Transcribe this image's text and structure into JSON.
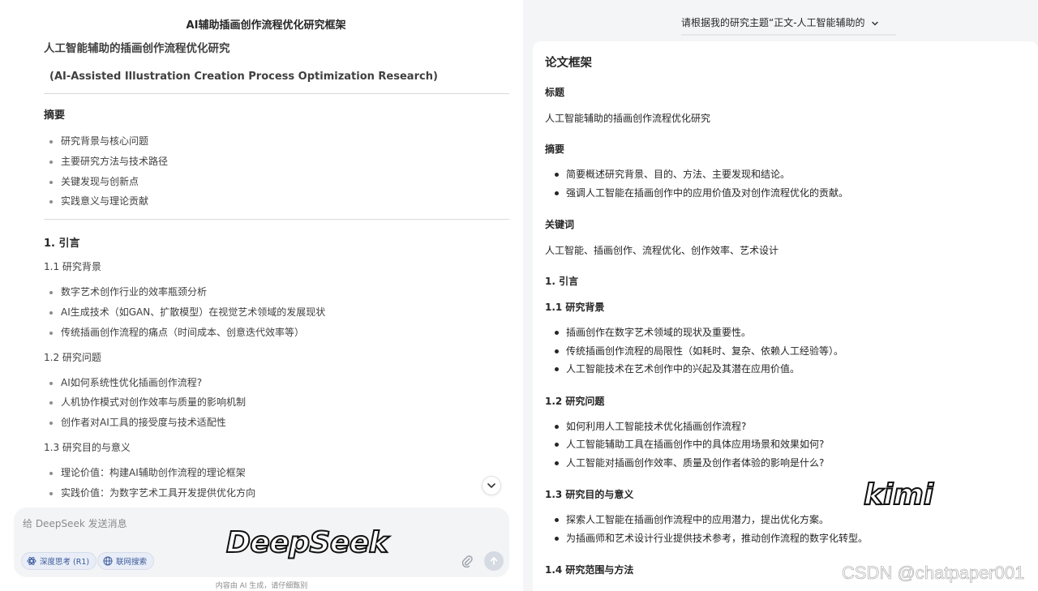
{
  "left": {
    "title": "AI辅助插画创作流程优化研究框架",
    "heading": "人工智能辅助的插画创作流程优化研究",
    "subheading": "(AI-Assisted Illustration Creation Process Optimization Research)",
    "abstract_title": "摘要",
    "abstract_items": [
      "研究背景与核心问题",
      "主要研究方法与技术路径",
      "关键发现与创新点",
      "实践意义与理论贡献"
    ],
    "sec1_title": "1. 引言",
    "s11_title": "1.1 研究背景",
    "s11_items": [
      "数字艺术创作行业的效率瓶颈分析",
      "AI生成技术（如GAN、扩散模型）在视觉艺术领域的发展现状",
      "传统插画创作流程的痛点（时间成本、创意迭代效率等）"
    ],
    "s12_title": "1.2 研究问题",
    "s12_items": [
      "AI如何系统性优化插画创作流程?",
      "人机协作模式对创作效率与质量的影响机制",
      "创作者对AI工具的接受度与技术适配性"
    ],
    "s13_title": "1.3 研究目的与意义",
    "s13_items": [
      "理论价值：构建AI辅助创作流程的理论框架",
      "实践价值：为数字艺术工具开发提供优化方向"
    ],
    "input_placeholder": "给 DeepSeek 发送消息",
    "chip_deepthink": "深度思考 (R1)",
    "chip_search": "联网搜索",
    "footnote": "内容由 AI 生成，请仔细甄别",
    "watermark": "DeepSeek"
  },
  "right": {
    "top_query": "请根据我的研究主题“正文-人工智能辅助的",
    "outline_title": "论文框架",
    "title_label": "标题",
    "title_value": "人工智能辅助的插画创作流程优化研究",
    "abstract_label": "摘要",
    "abstract_items": [
      "简要概述研究背景、目的、方法、主要发现和结论。",
      "强调人工智能在插画创作中的应用价值及对创作流程优化的贡献。"
    ],
    "keywords_label": "关键词",
    "keywords_value": "人工智能、插画创作、流程优化、创作效率、艺术设计",
    "sec1_title": "1. 引言",
    "s11_title": "1.1 研究背景",
    "s11_items": [
      "插画创作在数字艺术领域的现状及重要性。",
      "传统插画创作流程的局限性（如耗时、复杂、依赖人工经验等）。",
      "人工智能技术在艺术创作中的兴起及其潜在应用价值。"
    ],
    "s12_title": "1.2 研究问题",
    "s12_items": [
      "如何利用人工智能技术优化插画创作流程?",
      "人工智能辅助工具在插画创作中的具体应用场景和效果如何?",
      "人工智能对插画创作效率、质量及创作者体验的影响是什么?"
    ],
    "s13_title": "1.3 研究目的与意义",
    "s13_items": [
      "探索人工智能在插画创作流程中的应用潜力，提出优化方案。",
      "为插画师和艺术设计行业提供技术参考，推动创作流程的数字化转型。"
    ],
    "s14_title": "1.4 研究范围与方法",
    "watermark": "kimi",
    "csdn": "CSDN @chatpaper001"
  },
  "colors": {
    "chip_bg": "#e8edf7",
    "chip_text": "#3c5a9a",
    "composer_bg": "#f3f4f6",
    "right_bg": "#f4f5f7"
  }
}
